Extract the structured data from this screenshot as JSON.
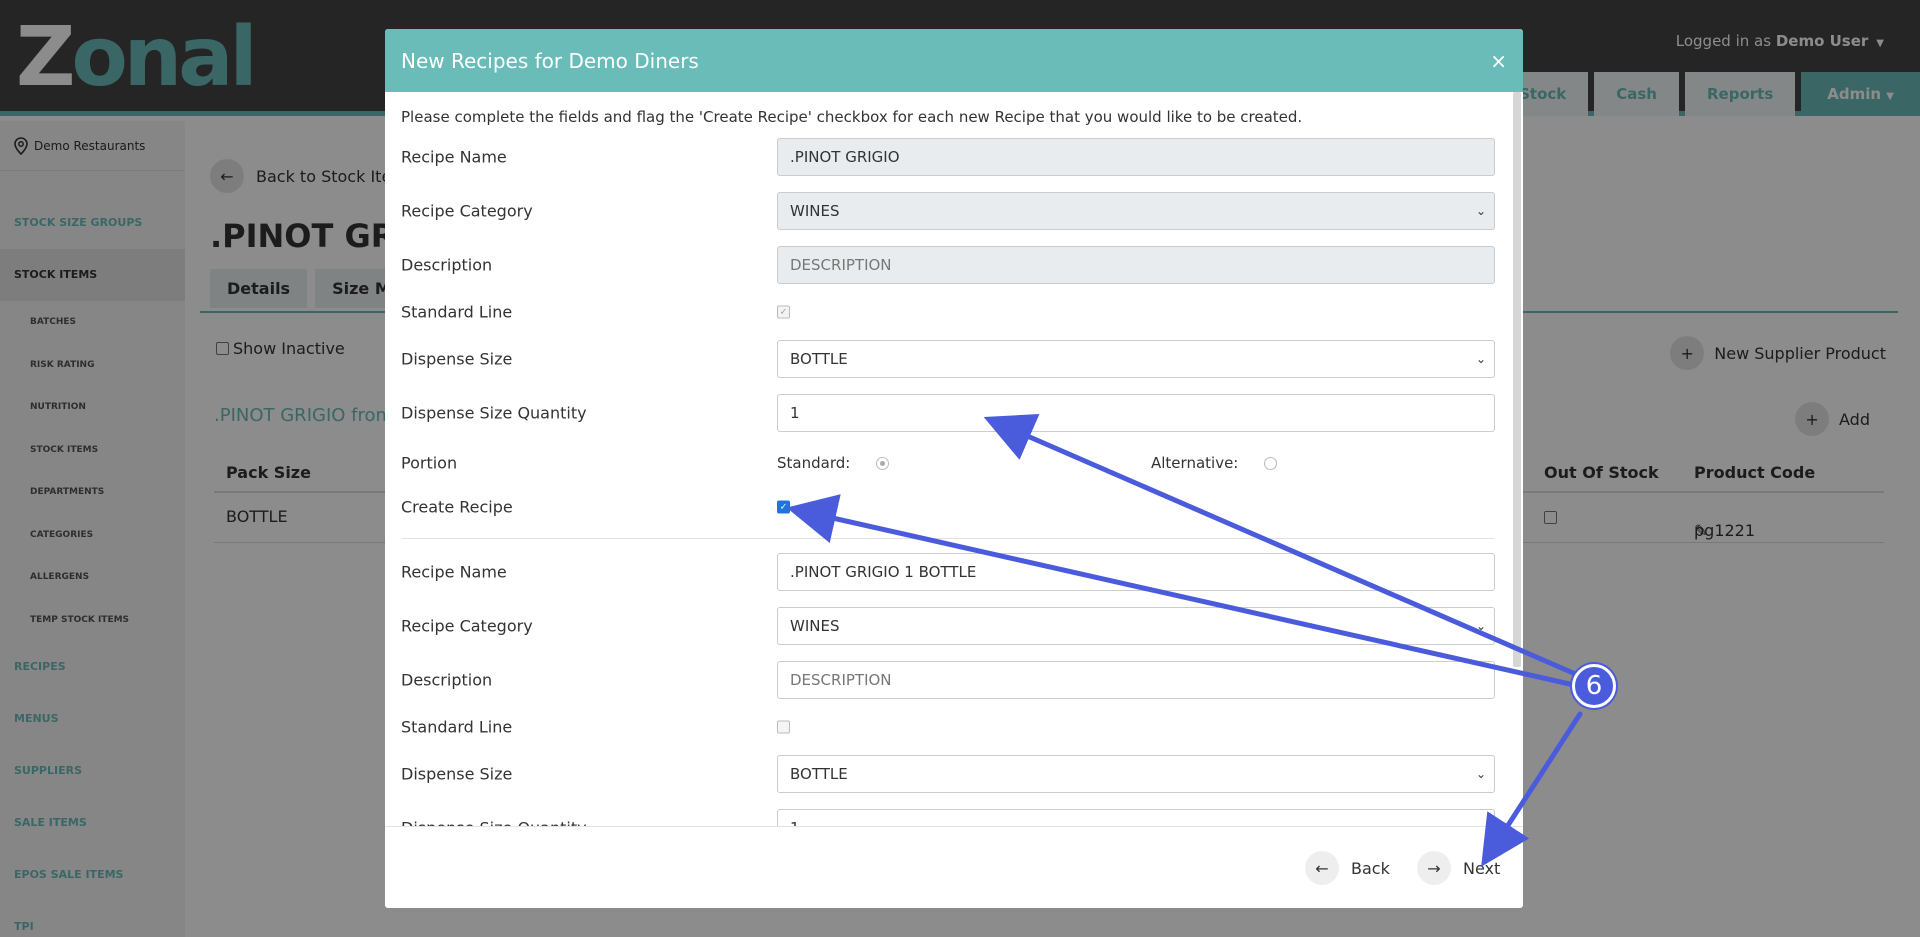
{
  "app": {
    "logo_text_first": "Z",
    "logo_text_rest": "onal",
    "login_prefix": "Logged in as",
    "login_user": "Demo User",
    "nav_tabs": [
      "Stock",
      "Cash",
      "Reports"
    ],
    "admin_label": "Admin"
  },
  "sidebar": {
    "location": "Demo Restaurants",
    "items": [
      {
        "label": "STOCK SIZE GROUPS",
        "level": "section"
      },
      {
        "label": "STOCK ITEMS",
        "level": "section",
        "active": true
      },
      {
        "label": "BATCHES",
        "level": "sub"
      },
      {
        "label": "RISK RATING",
        "level": "sub"
      },
      {
        "label": "NUTRITION",
        "level": "sub"
      },
      {
        "label": "STOCK ITEMS",
        "level": "sub"
      },
      {
        "label": "DEPARTMENTS",
        "level": "sub"
      },
      {
        "label": "CATEGORIES",
        "level": "sub"
      },
      {
        "label": "ALLERGENS",
        "level": "sub"
      },
      {
        "label": "TEMP STOCK ITEMS",
        "level": "sub"
      },
      {
        "label": "RECIPES",
        "level": "section"
      },
      {
        "label": "MENUS",
        "level": "section"
      },
      {
        "label": "SUPPLIERS",
        "level": "section"
      },
      {
        "label": "SALE ITEMS",
        "level": "section"
      },
      {
        "label": "EPOS SALE ITEMS",
        "level": "section"
      },
      {
        "label": "TPI",
        "level": "section"
      }
    ]
  },
  "main": {
    "back_label": "Back to Stock Ite",
    "page_title": ".PINOT GRIG",
    "tabs": [
      "Details",
      "Size Mu"
    ],
    "show_inactive": "Show Inactive",
    "new_supplier_product": "New Supplier Product",
    "add_label": "Add",
    "supplier_title": ".PINOT GRIGIO from",
    "table": {
      "headers": [
        "Pack Size",
        "Out Of Stock",
        "Product Code"
      ],
      "rows": [
        {
          "pack_size": "BOTTLE",
          "product_code": "pg1221"
        }
      ]
    }
  },
  "modal": {
    "title": "New Recipes for Demo Diners",
    "close": "×",
    "intro": "Please complete the fields and flag the 'Create Recipe' checkbox for each new Recipe that you would like to be created.",
    "labels": {
      "recipe_name": "Recipe Name",
      "recipe_category": "Recipe Category",
      "description": "Description",
      "standard_line": "Standard Line",
      "dispense_size": "Dispense Size",
      "dispense_size_quantity": "Dispense Size Quantity",
      "portion": "Portion",
      "standard": "Standard:",
      "alternative": "Alternative:",
      "create_recipe": "Create Recipe"
    },
    "recipe1": {
      "recipe_name": ".PINOT GRIGIO",
      "recipe_category": "WINES",
      "description_placeholder": "DESCRIPTION",
      "standard_line": true,
      "dispense_size": "BOTTLE",
      "dispense_size_quantity": "1",
      "portion": "standard",
      "create_recipe": true
    },
    "recipe2": {
      "recipe_name": ".PINOT GRIGIO 1 BOTTLE",
      "recipe_category": "WINES",
      "description_placeholder": "DESCRIPTION",
      "standard_line": false,
      "dispense_size": "BOTTLE",
      "dispense_size_quantity": "1"
    },
    "back_label": "Back",
    "next_label": "Next"
  },
  "annotation": {
    "marker": "6",
    "color": "#4a5bdc"
  },
  "colors": {
    "accent": "#6abcb9",
    "topbar": "#444444",
    "checkbox": "#2275d7"
  }
}
